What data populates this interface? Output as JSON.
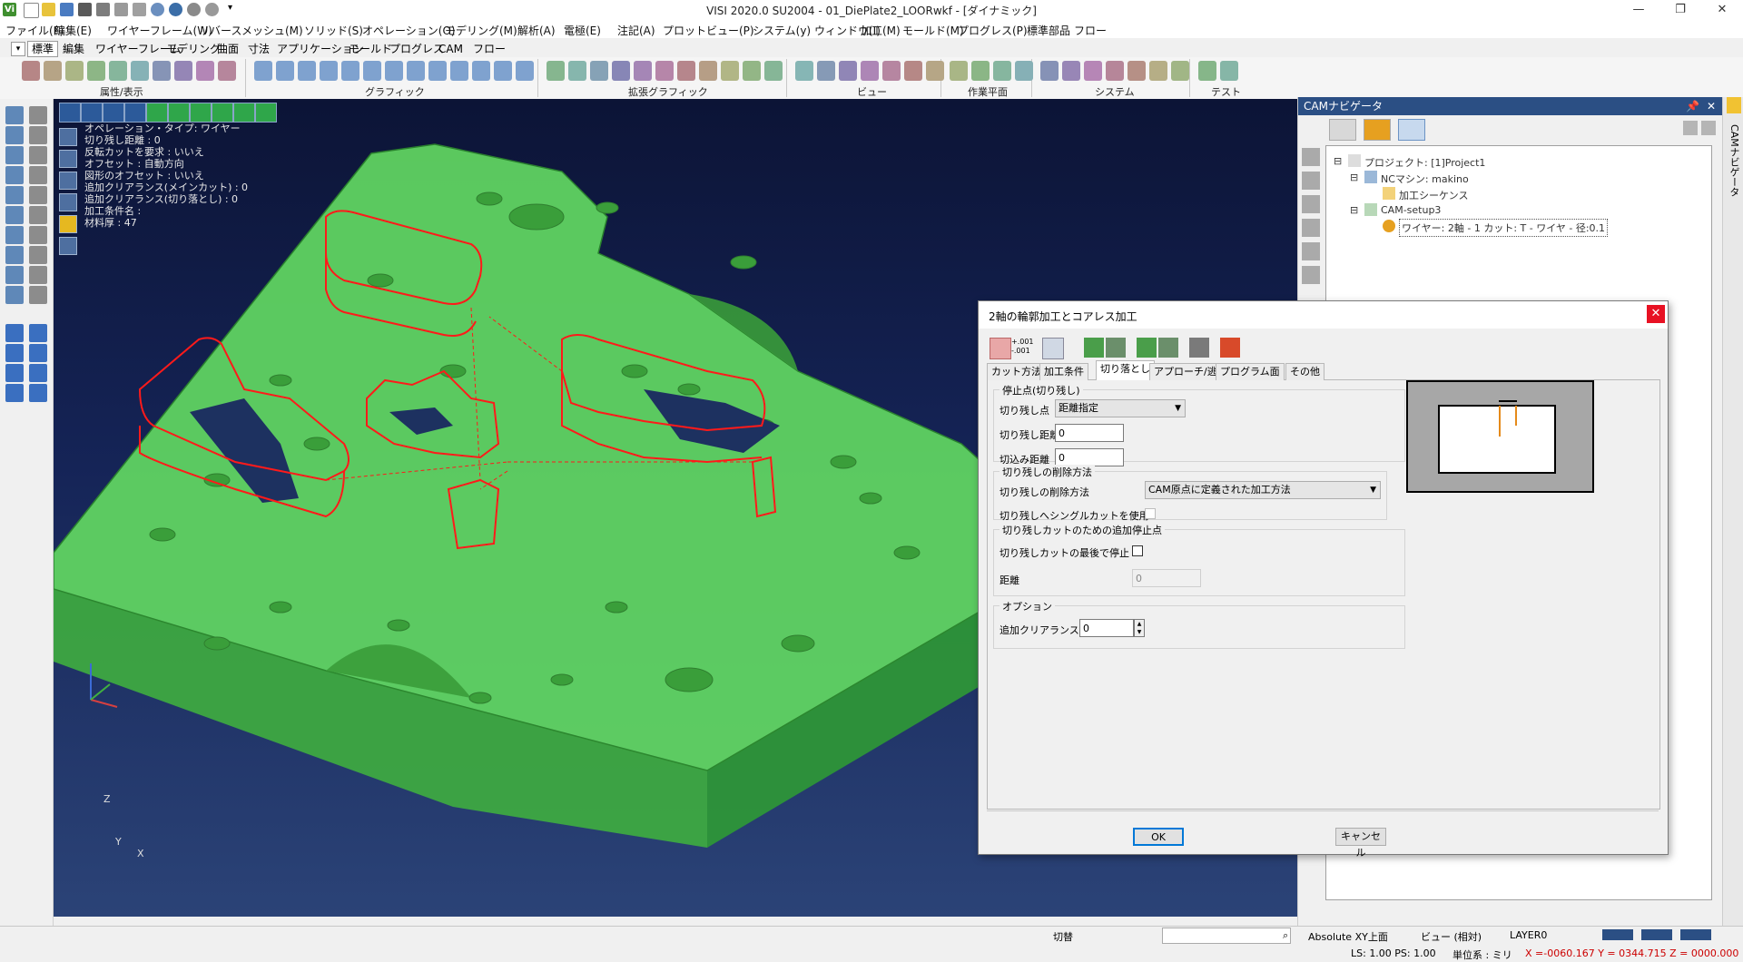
{
  "window": {
    "title": "VISI 2020.0 SU2004 - 01_DiePlate2_LOORwkf - [ダイナミック]",
    "app_badge": "Vi",
    "minimize": "—",
    "restore": "❐",
    "close": "✕"
  },
  "menu": [
    "ファイル(F)",
    "編集(E)",
    "ワイヤーフレーム(W)",
    "リバース",
    "メッシュ(M)",
    "ソリッド(S)",
    "オペレーション(O)",
    "モデリング(M)",
    "解析(A)",
    "電極(E)",
    "注記(A)",
    "プロットビュー(P)",
    "システム(y)",
    "ウィンドウ(I)",
    "加工(M)",
    "モールド(M)",
    "プログレス(P)",
    "標準部品",
    "フロー"
  ],
  "ribbon": {
    "tabs": [
      "標準",
      "編集",
      "ワイヤーフレーム",
      "モデリング",
      "曲面",
      "寸法",
      "アプリケーション",
      "モールド",
      "プログレス",
      "CAM",
      "フロー"
    ],
    "active_tab": "標準",
    "groups": [
      "属性/表示",
      "グラフィック",
      "拡張グラフィック",
      "ビュー",
      "作業平面",
      "システム",
      "テスト"
    ]
  },
  "viewport": {
    "info_lines": [
      "オペレーション・タイプ: ワイヤー",
      "切り残し距離 : 0",
      "反転カットを要求 : いいえ",
      "オフセット : 自動方向",
      "図形のオフセット : いいえ",
      "追加クリアランス(メインカット) : 0",
      "追加クリアランス(切り落とし) : 0",
      "加工条件名 :",
      "材料厚 : 47"
    ],
    "axis": {
      "x": "X",
      "y": "Y",
      "z": "Z"
    },
    "colors": {
      "plate": "#5fd35f",
      "toolpath": "#ff1a1a",
      "background": "#16275a"
    }
  },
  "cam_navigator": {
    "title": "CAMナビゲータ",
    "side_label": "CAMナビゲータ",
    "tree": {
      "project": "プロジェクト: [1]Project1",
      "machine": "NCマシン: makino",
      "sequence": "加工シーケンス",
      "setup": "CAM-setup3",
      "operation": "ワイヤー: 2軸 - 1 カット: T - ワイヤ - 径:0.1"
    }
  },
  "dialog": {
    "title": "2軸の輪郭加工とコアレス加工",
    "close": "✕",
    "toolbar_tolerance": "+.001\n-.001",
    "tabs": [
      "カット方法",
      "加工条件",
      "切り落とし",
      "アプローチ/逃げ",
      "プログラム面",
      "その他"
    ],
    "active_tab": "切り落とし",
    "stop_point": {
      "title": "停止点(切り残し)",
      "point_label": "切り残し点",
      "point_value": "距離指定",
      "distance_label": "切り残し距離",
      "distance_value": "0",
      "plunge_label": "切込み距離",
      "plunge_value": "0"
    },
    "removal": {
      "title": "切り残しの削除方法",
      "method_label": "切り残しの削除方法",
      "method_value": "CAM原点に定義された加工方法",
      "single_cut_label": "切り残しへシングルカットを使用"
    },
    "extra_stop": {
      "title": "切り残しカットのための追加停止点",
      "stop_end_label": "切り残しカットの最後で停止",
      "distance_label": "距離",
      "distance_value": "0"
    },
    "options": {
      "title": "オプション",
      "clearance_label": "追加クリアランス",
      "clearance_value": "0"
    },
    "ok": "OK",
    "cancel": "キャンセル"
  },
  "statusbar": {
    "mode": "切替",
    "plane": "Absolute XY上面",
    "view": "ビュー (相対)",
    "layer": "LAYER0",
    "ls_ps": "LS: 1.00 PS: 1.00",
    "units": "単位系 : ミリ",
    "coords": "X =-0060.167 Y = 0344.715 Z = 0000.000"
  }
}
